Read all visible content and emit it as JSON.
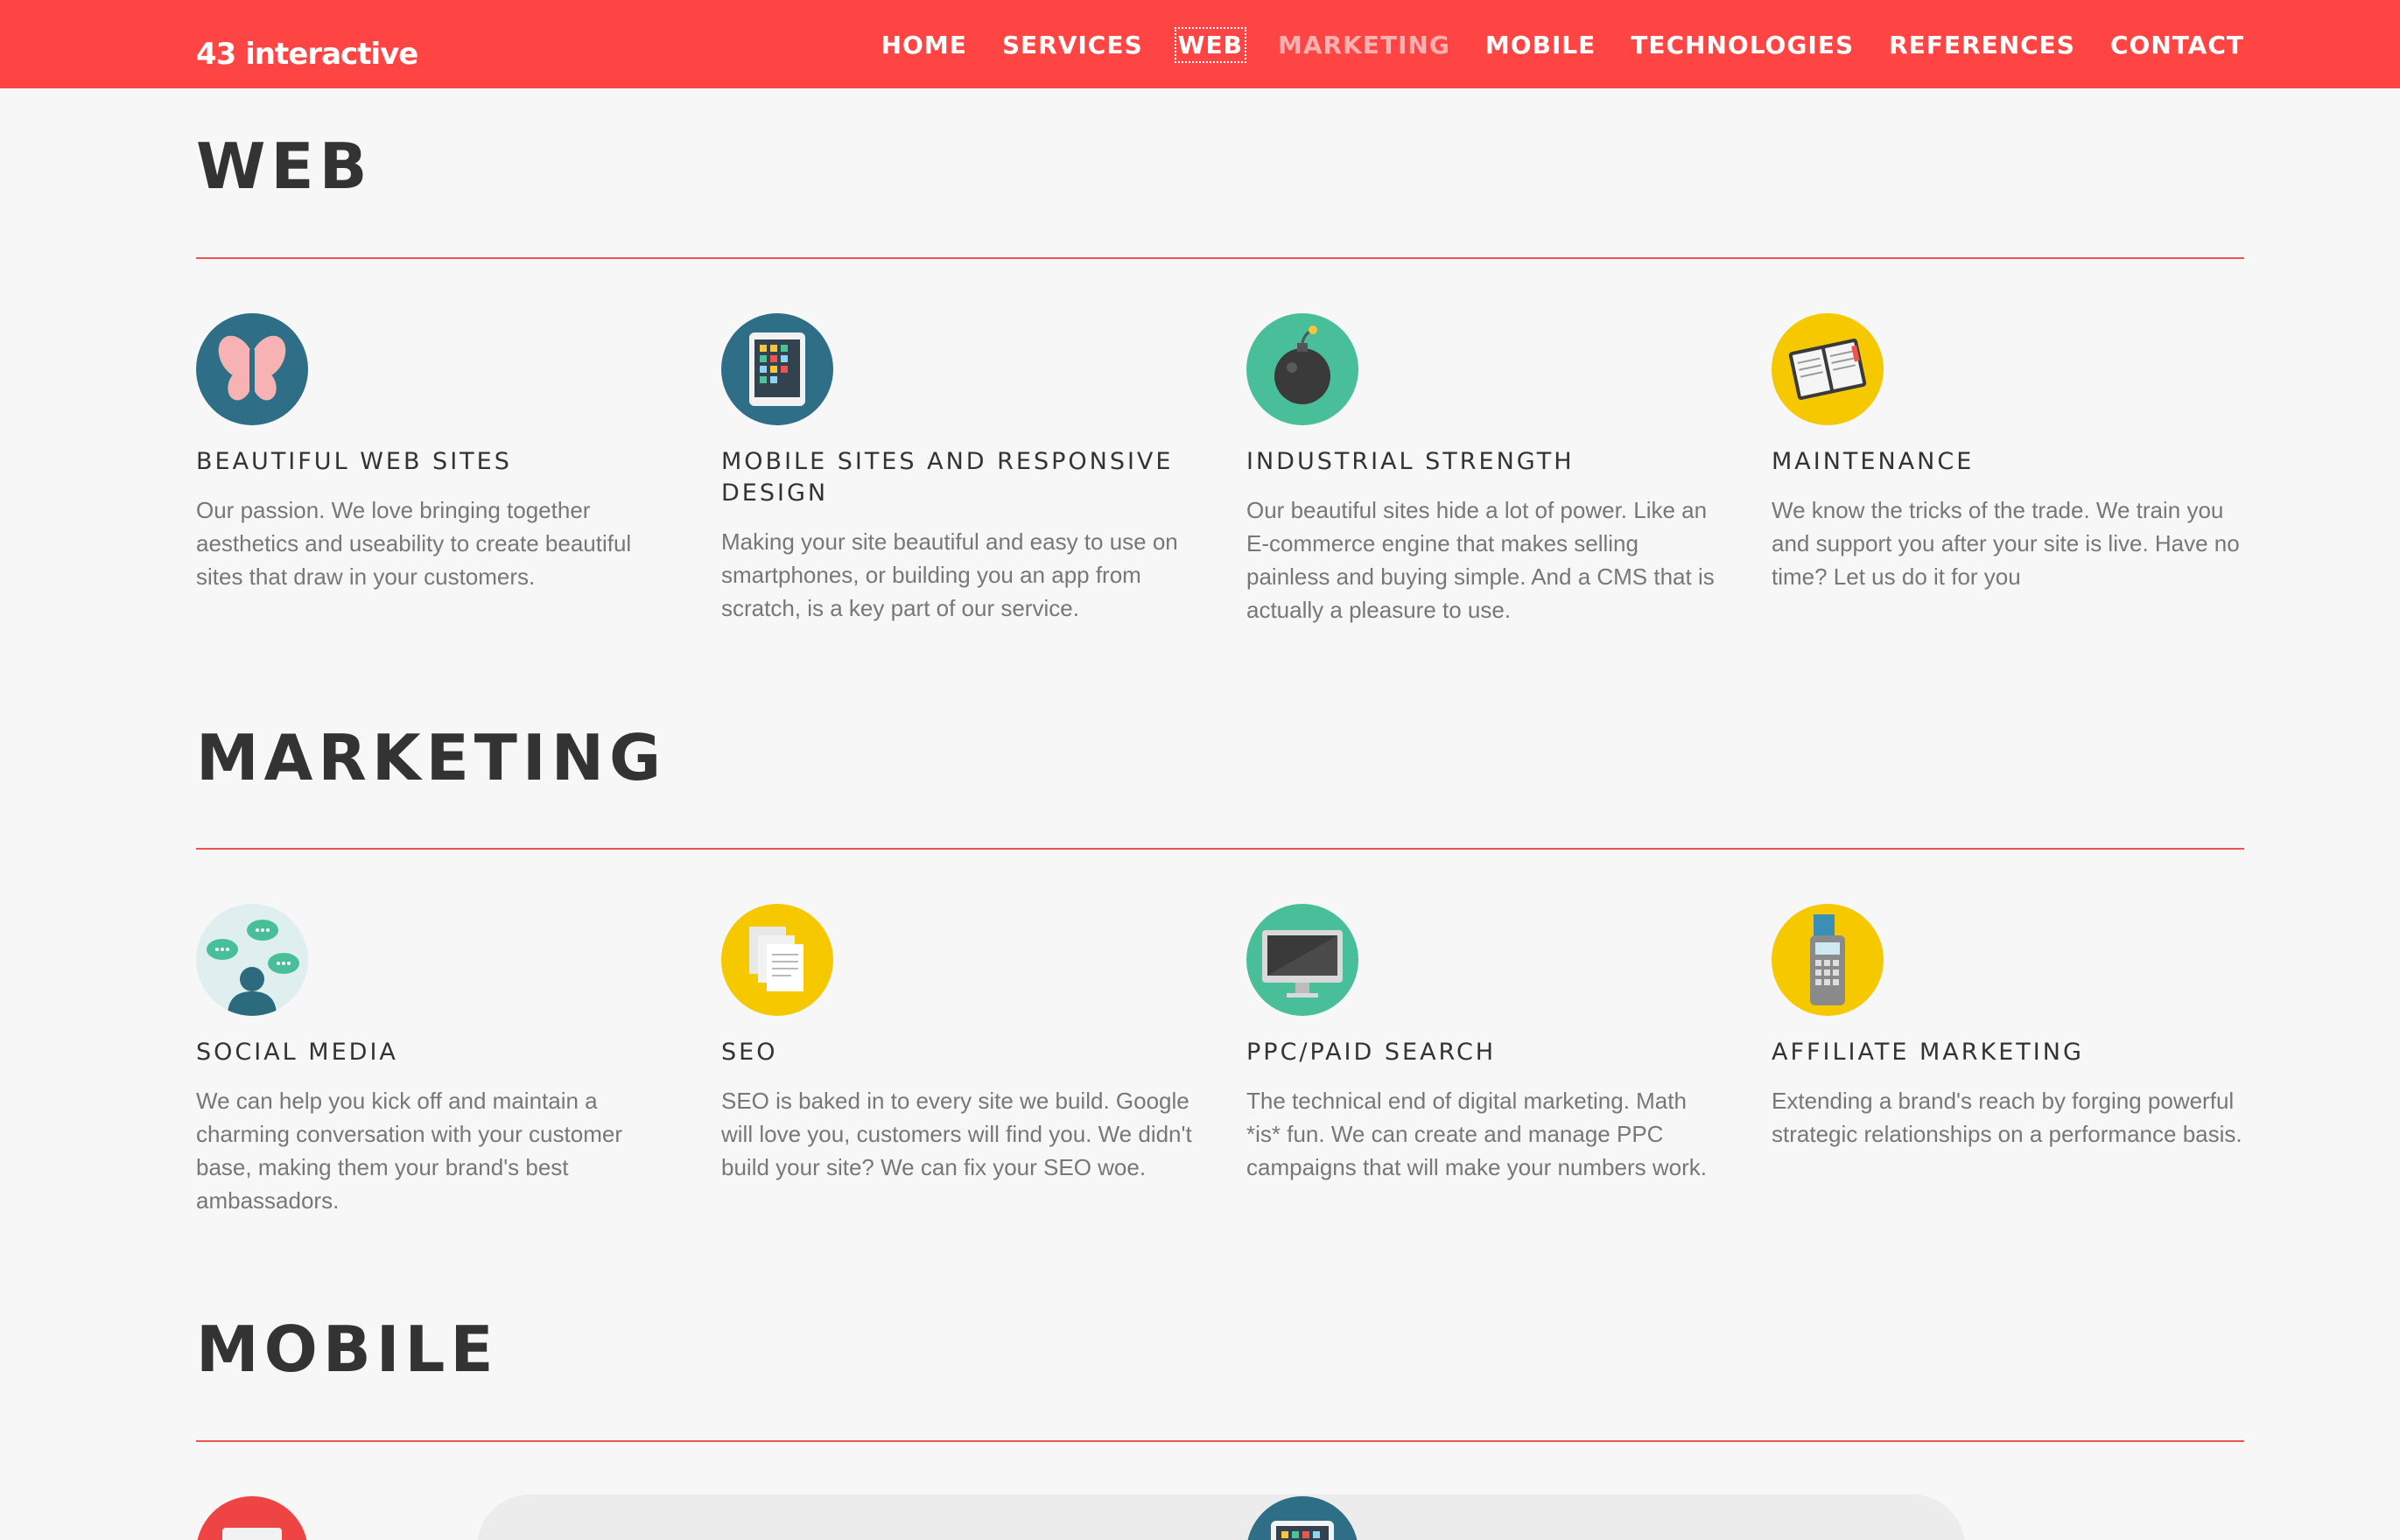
{
  "brand": {
    "logo_text": "43 interactive",
    "accent": "#ff4444"
  },
  "nav": {
    "items": [
      {
        "label": "HOME",
        "state": ""
      },
      {
        "label": "SERVICES",
        "state": ""
      },
      {
        "label": "WEB",
        "state": "active"
      },
      {
        "label": "MARKETING",
        "state": "hover"
      },
      {
        "label": "MOBILE",
        "state": ""
      },
      {
        "label": "TECHNOLOGIES",
        "state": ""
      },
      {
        "label": "REFERENCES",
        "state": ""
      },
      {
        "label": "CONTACT",
        "state": ""
      }
    ]
  },
  "sections": {
    "web": {
      "title": "WEB",
      "cards": [
        {
          "title": "BEAUTIFUL WEB SITES",
          "text": "Our passion. We love bringing together aesthetics and useability to create beautiful sites that draw in your customers.",
          "icon": "butterfly-icon"
        },
        {
          "title": "MOBILE SITES AND RESPONSIVE DESIGN",
          "text": "Making your site beautiful and easy to use on smartphones, or building you an app from scratch, is a key part of our service.",
          "icon": "tablet-icon"
        },
        {
          "title": "INDUSTRIAL STRENGTH",
          "text": "Our beautiful sites hide a lot of power. Like an E-commerce engine that makes selling painless and buying simple. And a CMS that is actually a pleasure to use.",
          "icon": "bomb-icon"
        },
        {
          "title": "MAINTENANCE",
          "text": "We know the tricks of the trade. We train you and support you after your site is live. Have no time? Let us do it for you",
          "icon": "manual-icon"
        }
      ]
    },
    "marketing": {
      "title": "MARKETING",
      "cards": [
        {
          "title": "SOCIAL MEDIA",
          "text": "We can help you kick off and maintain a charming conversation with your customer base, making them your brand's best ambassadors.",
          "icon": "chat-bubbles-icon"
        },
        {
          "title": "SEO",
          "text": "SEO is baked in to every site we build. Google will love you, customers will find you. We didn't build your site? We can fix your SEO woe.",
          "icon": "documents-icon"
        },
        {
          "title": "PPC/PAID SEARCH",
          "text": "The technical end of digital marketing. Math *is* fun. We can create and manage PPC campaigns that will make your numbers work.",
          "icon": "monitor-icon"
        },
        {
          "title": "AFFILIATE MARKETING",
          "text": "Extending a brand's reach by forging powerful strategic relationships on a performance basis.",
          "icon": "card-terminal-icon"
        }
      ]
    },
    "mobile": {
      "title": "MOBILE"
    }
  }
}
